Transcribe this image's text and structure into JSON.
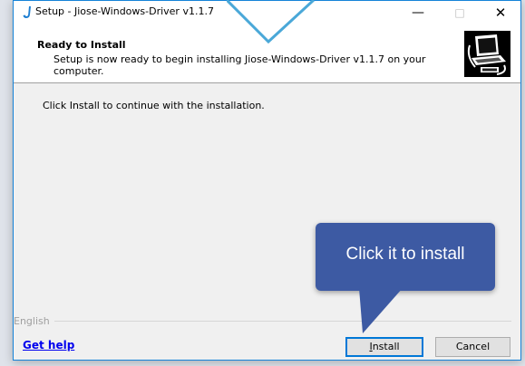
{
  "window": {
    "title": "Setup - Jiose-Windows-Driver v1.1.7",
    "controls": {
      "minimize": "—",
      "maximize": "□",
      "close": "✕"
    }
  },
  "header": {
    "title": "Ready to Install",
    "subtitle": "Setup is now ready to begin installing Jiose-Windows-Driver v1.1.7 on your computer.",
    "logo_icon": "computer-install-icon"
  },
  "body": {
    "instruction": "Click Install to continue with the installation."
  },
  "footer": {
    "language": "English",
    "help_link": "Get help",
    "install_accel": "I",
    "install_rest": "nstall",
    "cancel_label": "Cancel"
  },
  "callout": {
    "text": "Click it to install",
    "color": "#3d5aa3"
  },
  "colors": {
    "window_border": "#1683d8",
    "link": "#0000ee",
    "dialog_bg": "#f0f0f0",
    "default_button_border": "#0078d7"
  }
}
